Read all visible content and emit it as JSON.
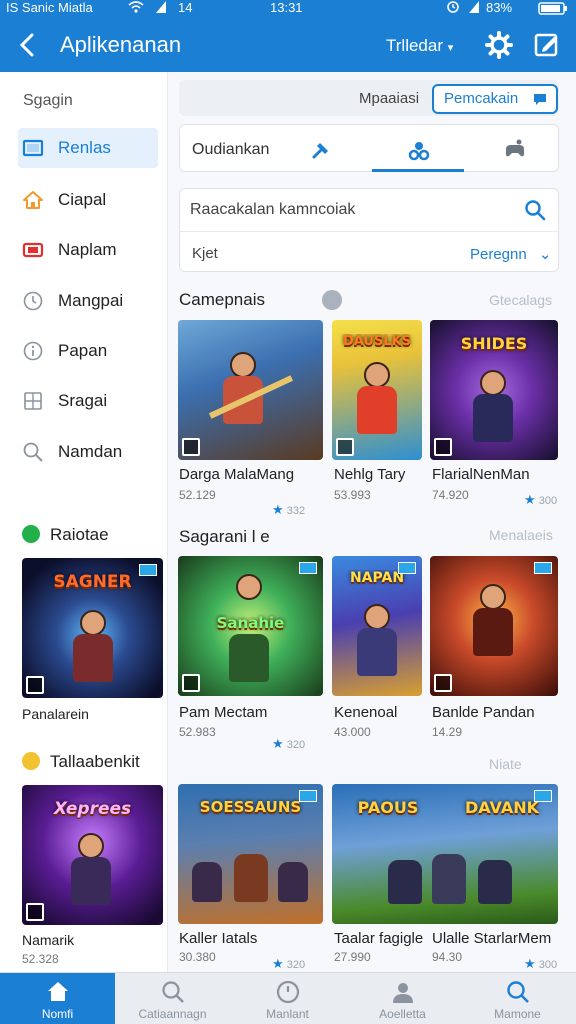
{
  "status_bar": {
    "left": "IS Sanic Miatla",
    "time": "13:31",
    "clock_small": "14",
    "battery": "83%"
  },
  "app_bar": {
    "back_icon": "chevron-left-icon",
    "title": "Aplikenanan",
    "filter_label": "Trlledar",
    "icons": [
      "settings-gear-icon",
      "edit-square-icon"
    ]
  },
  "sidebar": {
    "heading": "Sgagin",
    "items": [
      {
        "label": "Renlas",
        "icon": "monitor-icon",
        "active": true
      },
      {
        "label": "Ciapal",
        "icon": "home-icon",
        "active": false
      },
      {
        "label": "Naplam",
        "icon": "ticket-icon",
        "active": false
      },
      {
        "label": "Mangpai",
        "icon": "clock-icon",
        "active": false
      },
      {
        "label": "Papan",
        "icon": "info-icon",
        "active": false
      },
      {
        "label": "Sragai",
        "icon": "grid-icon",
        "active": false
      },
      {
        "label": "Namdan",
        "icon": "search-icon",
        "active": false
      }
    ],
    "sections": [
      {
        "title": "Raiotae",
        "dot_color": "#22b04b",
        "card": {
          "art_text": "SAGNER",
          "title": "Panalarein",
          "meta": ""
        }
      },
      {
        "title": "Tallaabenkit",
        "dot_color": "#f2c230",
        "card": {
          "art_text": "Xeprees",
          "title": "Namarik",
          "meta": "52.328"
        }
      }
    ]
  },
  "main": {
    "search_row": {
      "text": "Mpaaiasi",
      "button": "Pemcakain"
    },
    "tabs": {
      "label": "Oudiankan",
      "icons": [
        "pin-icon",
        "users-icon",
        "gamepad-icon"
      ]
    },
    "search": {
      "placeholder": "Raacakalan kamncoiak",
      "sort_label": "Kjet",
      "sort_value": "Peregnn"
    },
    "sections": [
      {
        "title": "Camepnais",
        "link": "Gtecalags",
        "games": [
          {
            "art_text": "",
            "title": "Darga MalaMang",
            "meta": "52.129",
            "rating": "332",
            "colors": [
              "#3b6fb0",
              "#c9523b"
            ]
          },
          {
            "art_text": "DAUSLKS",
            "title": "Nehlg Tary",
            "meta": "53.993",
            "rating": "",
            "colors": [
              "#e9c23a",
              "#2e8fd1"
            ]
          },
          {
            "art_text": "SHIDES",
            "title": "FlarialNenMan",
            "meta": "74.920",
            "rating": "300",
            "colors": [
              "#6b2fa8",
              "#2a2a5a"
            ]
          }
        ]
      },
      {
        "title": "Sagarani l e",
        "link": "Menalaeis",
        "games": [
          {
            "art_text": "Sanahie",
            "title": "Pam Mectam",
            "meta": "52.983",
            "rating": "320",
            "colors": [
              "#3fb05a",
              "#2b5a2a"
            ]
          },
          {
            "art_text": "NAPAN",
            "title": "Kenenoal",
            "meta": "43.000",
            "rating": "",
            "colors": [
              "#4a3fb0",
              "#d9a030"
            ]
          },
          {
            "art_text": "",
            "title": "Banlde Pandan",
            "meta": "14.29",
            "rating": "",
            "colors": [
              "#c94a2a",
              "#5a1a12"
            ]
          }
        ]
      },
      {
        "title": "",
        "link": "Niate",
        "games": [
          {
            "art_text": "SOESSAUNS",
            "title": "Kaller Iatals",
            "meta": "30.380",
            "rating": "320",
            "colors": [
              "#2f6fb0",
              "#c0702a"
            ]
          },
          {
            "art_text": "PAOUS",
            "title": "Taalar fagigle",
            "meta": "27.990",
            "rating": "",
            "colors": [
              "#2a6fb8",
              "#4a8a2a"
            ]
          },
          {
            "art_text": "DAVANK",
            "title": "Ulalle StarlarMem",
            "meta": "94.30",
            "rating": "300",
            "colors": [
              "#3a78c8",
              "#386b28"
            ]
          }
        ]
      }
    ]
  },
  "bottom_nav": [
    {
      "label": "Nomfi",
      "icon": "home-icon",
      "active": true
    },
    {
      "label": "Catiaannagn",
      "icon": "search-icon",
      "active": false
    },
    {
      "label": "Manlant",
      "icon": "clock-icon",
      "active": false
    },
    {
      "label": "Aoelletta",
      "icon": "user-icon",
      "active": false
    },
    {
      "label": "Mamone",
      "icon": "search-icon",
      "active": false
    }
  ]
}
